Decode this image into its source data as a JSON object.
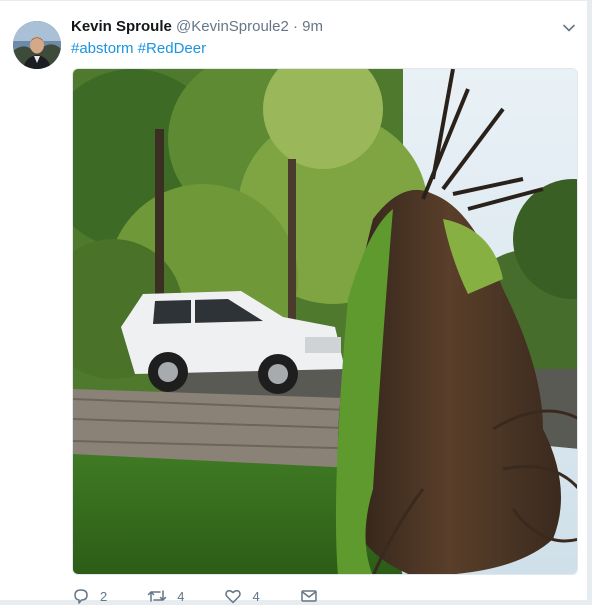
{
  "tweet": {
    "author_name": "Kevin Sproule",
    "handle": "@KevinSproule2",
    "separator": "·",
    "time": "9m",
    "hashtags": [
      "#abstorm",
      "#RedDeer"
    ],
    "media_alt": "Uprooted tree fallen across a driveway next to a white SUV",
    "actions": {
      "reply_count": "2",
      "retweet_count": "4",
      "like_count": "4"
    }
  },
  "icons": [
    "chevron-down-icon",
    "reply-icon",
    "retweet-icon",
    "like-icon",
    "direct-message-icon"
  ],
  "colors": {
    "link": "#1b95e0",
    "secondary": "#657786",
    "text": "#14171a"
  }
}
